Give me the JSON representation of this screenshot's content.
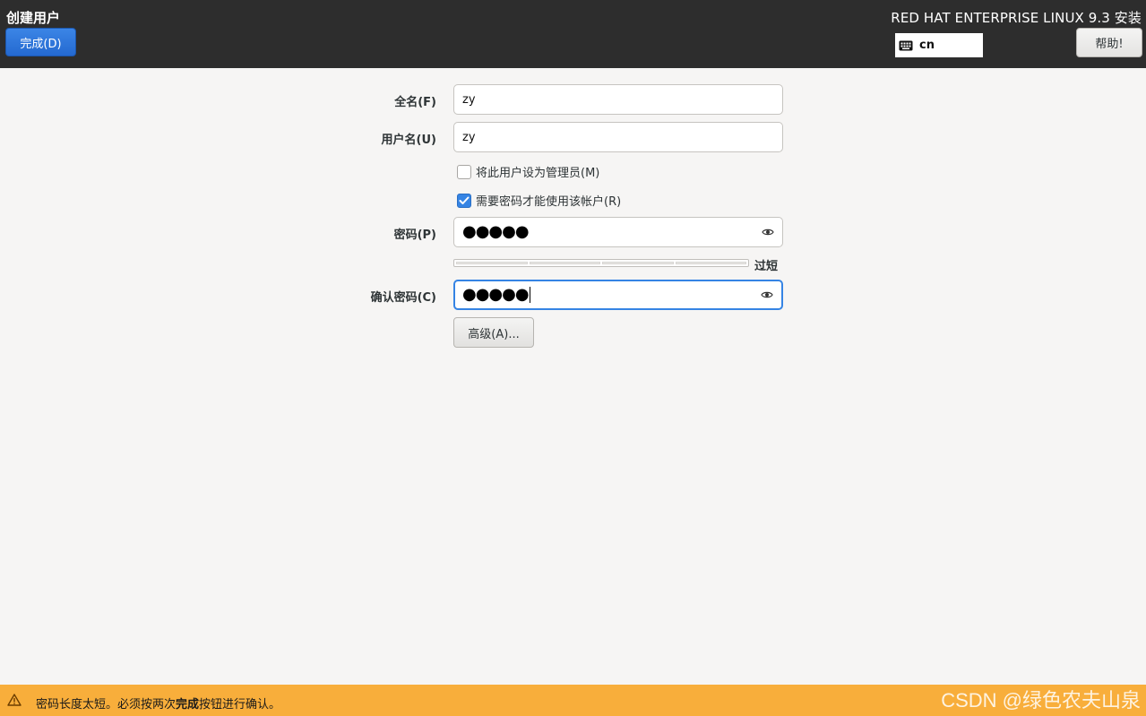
{
  "header": {
    "page_title": "创建用户",
    "done_button": "完成(D)",
    "product_title": "RED HAT ENTERPRISE LINUX 9.3 安装",
    "keyboard_layout": "cn",
    "help_button": "帮助!"
  },
  "form": {
    "fullname_label": "全名(F)",
    "fullname_value": "zy",
    "username_label": "用户名(U)",
    "username_value": "zy",
    "admin_checkbox_label": "将此用户设为管理员(M)",
    "admin_checked": false,
    "require_password_label": "需要密码才能使用该帐户(R)",
    "require_password_checked": true,
    "password_label": "密码(P)",
    "password_mask": "●●●●●",
    "strength_text": "过短",
    "confirm_label": "确认密码(C)",
    "confirm_mask": "●●●●●",
    "advanced_button": "高级(A)..."
  },
  "status": {
    "text_prefix": "密码长度太短。必须按两次",
    "text_bold": "完成",
    "text_suffix": "按钮进行确认。"
  },
  "watermark": "CSDN @绿色农夫山泉",
  "colors": {
    "header_bg": "#2d2d2d",
    "accent_blue": "#3584e4",
    "warning_bar": "#f8ae3b",
    "page_bg": "#f6f5f4"
  },
  "icons": {
    "keyboard": "keyboard-icon",
    "eye": "eye-icon",
    "warning": "warning-icon",
    "check": "checkmark-icon"
  }
}
